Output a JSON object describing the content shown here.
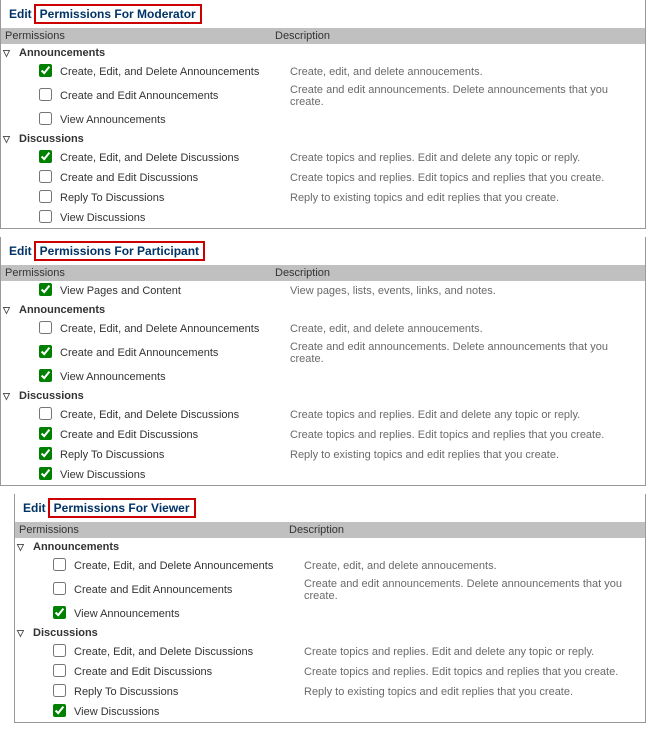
{
  "col_permissions": "Permissions",
  "col_description": "Description",
  "edit_label": "Edit",
  "sections": [
    {
      "id": "moderator",
      "title": "Permissions For Moderator",
      "groups": [
        {
          "name": "Announcements",
          "items": [
            {
              "checked": true,
              "label": "Create, Edit, and Delete Announcements",
              "desc": "Create, edit, and delete annoucements."
            },
            {
              "checked": false,
              "label": "Create and Edit Announcements",
              "desc": "Create and edit announcements. Delete announcements that you create."
            },
            {
              "checked": false,
              "label": "View Announcements",
              "desc": ""
            }
          ]
        },
        {
          "name": "Discussions",
          "items": [
            {
              "checked": true,
              "label": "Create, Edit, and Delete Discussions",
              "desc": "Create topics and replies. Edit and delete any topic or reply."
            },
            {
              "checked": false,
              "label": "Create and Edit Discussions",
              "desc": "Create topics and replies. Edit topics and replies that you create."
            },
            {
              "checked": false,
              "label": "Reply To Discussions",
              "desc": "Reply to existing topics and edit replies that you create."
            },
            {
              "checked": false,
              "label": "View Discussions",
              "desc": ""
            }
          ]
        }
      ]
    },
    {
      "id": "participant",
      "title": "Permissions For Participant",
      "pre_items": [
        {
          "checked": true,
          "label": "View Pages and Content",
          "desc": "View pages, lists, events, links, and notes."
        }
      ],
      "groups": [
        {
          "name": "Announcements",
          "items": [
            {
              "checked": false,
              "label": "Create, Edit, and Delete Announcements",
              "desc": "Create, edit, and delete annoucements."
            },
            {
              "checked": true,
              "label": "Create and Edit Announcements",
              "desc": "Create and edit announcements. Delete announcements that you create."
            },
            {
              "checked": true,
              "label": "View Announcements",
              "desc": ""
            }
          ]
        },
        {
          "name": "Discussions",
          "items": [
            {
              "checked": false,
              "label": "Create, Edit, and Delete Discussions",
              "desc": "Create topics and replies. Edit and delete any topic or reply."
            },
            {
              "checked": true,
              "label": "Create and Edit Discussions",
              "desc": "Create topics and replies. Edit topics and replies that you create."
            },
            {
              "checked": true,
              "label": "Reply To Discussions",
              "desc": "Reply to existing topics and edit replies that you create."
            },
            {
              "checked": true,
              "label": "View Discussions",
              "desc": ""
            }
          ]
        }
      ]
    },
    {
      "id": "viewer",
      "title": "Permissions For Viewer",
      "indent": true,
      "groups": [
        {
          "name": "Announcements",
          "items": [
            {
              "checked": false,
              "label": "Create, Edit, and Delete Announcements",
              "desc": "Create, edit, and delete annoucements."
            },
            {
              "checked": false,
              "label": "Create and Edit Announcements",
              "desc": "Create and edit announcements. Delete announcements that you create."
            },
            {
              "checked": true,
              "label": "View Announcements",
              "desc": ""
            }
          ]
        },
        {
          "name": "Discussions",
          "items": [
            {
              "checked": false,
              "label": "Create, Edit, and Delete Discussions",
              "desc": "Create topics and replies. Edit and delete any topic or reply."
            },
            {
              "checked": false,
              "label": "Create and Edit Discussions",
              "desc": "Create topics and replies. Edit topics and replies that you create."
            },
            {
              "checked": false,
              "label": "Reply To Discussions",
              "desc": "Reply to existing topics and edit replies that you create."
            },
            {
              "checked": true,
              "label": "View Discussions",
              "desc": ""
            }
          ]
        }
      ]
    }
  ]
}
